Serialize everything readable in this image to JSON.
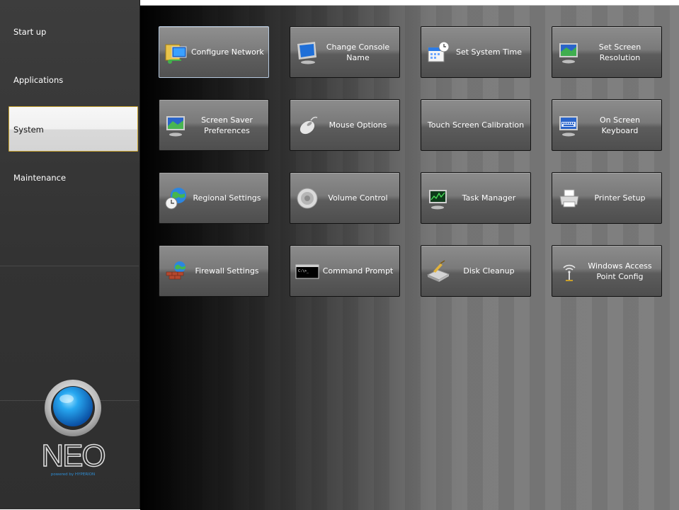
{
  "sidebar": {
    "items": [
      {
        "label": "Start up",
        "active": false
      },
      {
        "label": "Applications",
        "active": false
      },
      {
        "label": "System",
        "active": true
      },
      {
        "label": "Maintenance",
        "active": false
      }
    ],
    "logo": {
      "brand": "NEO",
      "tagline": "powered by HYPERION"
    }
  },
  "tiles": [
    {
      "label": "Configure Network",
      "icon": "network-folder-icon"
    },
    {
      "label": "Change Console\nName",
      "icon": "monitor-icon"
    },
    {
      "label": "Set System Time",
      "icon": "calendar-clock-icon"
    },
    {
      "label": "Set Screen\nResolution",
      "icon": "display-settings-icon"
    },
    {
      "label": "Screen Saver\nPreferences",
      "icon": "screen-saver-icon"
    },
    {
      "label": "Mouse Options",
      "icon": "mouse-icon"
    },
    {
      "label": "Touch Screen Calibration",
      "icon": ""
    },
    {
      "label": "On Screen\nKeyboard",
      "icon": "keyboard-monitor-icon"
    },
    {
      "label": "Regional Settings",
      "icon": "globe-clock-icon"
    },
    {
      "label": "Volume Control",
      "icon": "speaker-icon"
    },
    {
      "label": "Task Manager",
      "icon": "task-manager-icon"
    },
    {
      "label": "Printer Setup",
      "icon": "printer-icon"
    },
    {
      "label": "Firewall Settings",
      "icon": "firewall-icon"
    },
    {
      "label": "Command Prompt",
      "icon": "command-prompt-icon"
    },
    {
      "label": "Disk Cleanup",
      "icon": "disk-cleanup-icon"
    },
    {
      "label": "Windows Access\nPoint Config",
      "icon": "wireless-access-point-icon"
    }
  ],
  "colors": {
    "sidebar_bg": "#3a3a3a",
    "active_border": "#c8a431",
    "tile_text": "#ffffff"
  }
}
